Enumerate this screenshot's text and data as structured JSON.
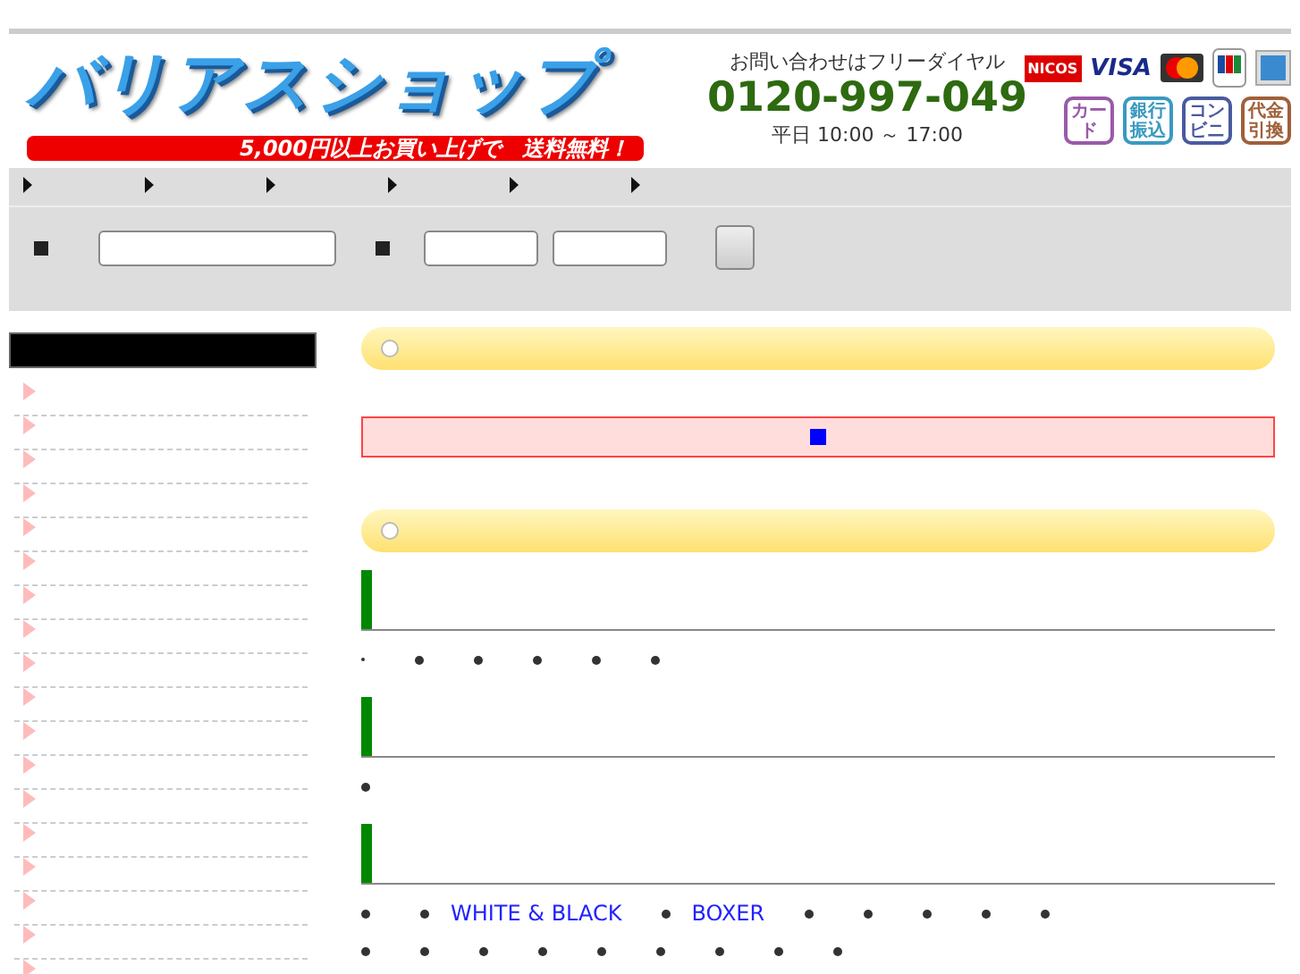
{
  "header": {
    "logo": "バリアスショップ",
    "promo": "5,000円以上お買い上げで　送料無料！",
    "contact_label": "お問い合わせはフリーダイヤル",
    "phone": "0120-997-049",
    "hours": "平日 10:00 ～ 17:00",
    "cards": [
      {
        "kind": "nicos",
        "label": "NICOS"
      },
      {
        "kind": "visa",
        "label": "VISA"
      },
      {
        "kind": "master"
      },
      {
        "kind": "jcb"
      },
      {
        "kind": "amex"
      }
    ],
    "payments": [
      {
        "label": "カード",
        "color": "#9a5aa8"
      },
      {
        "label": "銀行振込",
        "color": "#3a9ac0"
      },
      {
        "label": "コンビニ",
        "color": "#4a5aa0"
      },
      {
        "label": "代金引換",
        "color": "#a0603a"
      }
    ]
  },
  "nav": {
    "items": [
      {
        "kind": "arrow"
      },
      {
        "kind": "arrow"
      },
      {
        "kind": "arrow"
      },
      {
        "kind": "arrow"
      },
      {
        "kind": "arrow"
      },
      {
        "kind": "arrow"
      }
    ]
  },
  "search": {
    "fields": [
      {
        "kind": "marker"
      },
      {
        "kind": "field"
      },
      {
        "kind": "marker"
      },
      {
        "kind": "short-field"
      },
      {
        "kind": "short-field"
      },
      {
        "kind": "button"
      }
    ]
  },
  "sidebar": {
    "items": [
      {
        "kind": "arrow"
      },
      {
        "kind": "arrow"
      },
      {
        "kind": "arrow"
      },
      {
        "kind": "arrow"
      },
      {
        "kind": "arrow"
      },
      {
        "kind": "arrow"
      },
      {
        "kind": "arrow"
      },
      {
        "kind": "arrow"
      },
      {
        "kind": "arrow"
      },
      {
        "kind": "arrow"
      },
      {
        "kind": "arrow"
      },
      {
        "kind": "arrow"
      },
      {
        "kind": "arrow"
      },
      {
        "kind": "arrow"
      },
      {
        "kind": "arrow"
      },
      {
        "kind": "arrow"
      },
      {
        "kind": "arrow"
      },
      {
        "kind": "arrow"
      }
    ]
  },
  "main": {
    "sections": [
      {
        "kind": "pill"
      },
      {
        "kind": "notice"
      },
      {
        "kind": "pill"
      },
      {
        "kind": "heading"
      },
      {
        "kind": "list",
        "items": [
          {
            "kind": "small-dot"
          },
          {
            "kind": "dot"
          },
          {
            "kind": "dot"
          },
          {
            "kind": "dot"
          },
          {
            "kind": "dot"
          },
          {
            "kind": "dot"
          }
        ]
      },
      {
        "kind": "heading"
      },
      {
        "kind": "list",
        "items": [
          {
            "kind": "dot"
          }
        ]
      },
      {
        "kind": "heading"
      },
      {
        "kind": "list",
        "items": [
          {
            "kind": "dot"
          },
          {
            "kind": "dot"
          },
          {
            "kind": "link",
            "text": "WHITE & BLACK"
          },
          {
            "kind": "dot"
          },
          {
            "kind": "link",
            "text": "BOXER"
          },
          {
            "kind": "dot"
          },
          {
            "kind": "dot"
          },
          {
            "kind": "dot"
          },
          {
            "kind": "dot"
          },
          {
            "kind": "dot"
          }
        ]
      },
      {
        "kind": "list",
        "items": [
          {
            "kind": "dot"
          },
          {
            "kind": "dot"
          },
          {
            "kind": "dot"
          },
          {
            "kind": "dot"
          },
          {
            "kind": "dot"
          },
          {
            "kind": "dot"
          },
          {
            "kind": "dot"
          },
          {
            "kind": "dot"
          },
          {
            "kind": "dot"
          }
        ]
      }
    ]
  }
}
